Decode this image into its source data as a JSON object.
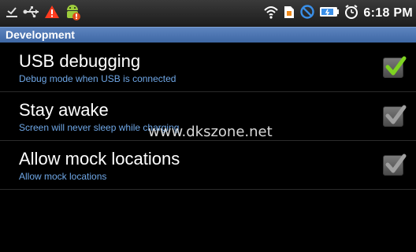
{
  "status_bar": {
    "time": "6:18 PM",
    "icons_left": [
      "usb-debug-icon",
      "usb-icon",
      "warning-icon",
      "android-icon"
    ],
    "icons_right": [
      "wifi-icon",
      "sim-icon",
      "no-sign-icon",
      "battery-icon",
      "alarm-clock-icon"
    ]
  },
  "title_bar": {
    "title": "Development"
  },
  "settings": [
    {
      "title": "USB debugging",
      "summary": "Debug mode when USB is connected",
      "checked": true,
      "enabled": true
    },
    {
      "title": "Stay awake",
      "summary": "Screen will never sleep while charging",
      "checked": true,
      "enabled": false
    },
    {
      "title": "Allow mock locations",
      "summary": "Allow mock locations",
      "checked": true,
      "enabled": false
    }
  ],
  "watermark": "www.dkszone.net",
  "colors": {
    "title_bar": "#4a73b0",
    "summary_text": "#6fa7e6",
    "check_enabled": "#7ed321",
    "check_disabled": "#a0a0a0"
  }
}
